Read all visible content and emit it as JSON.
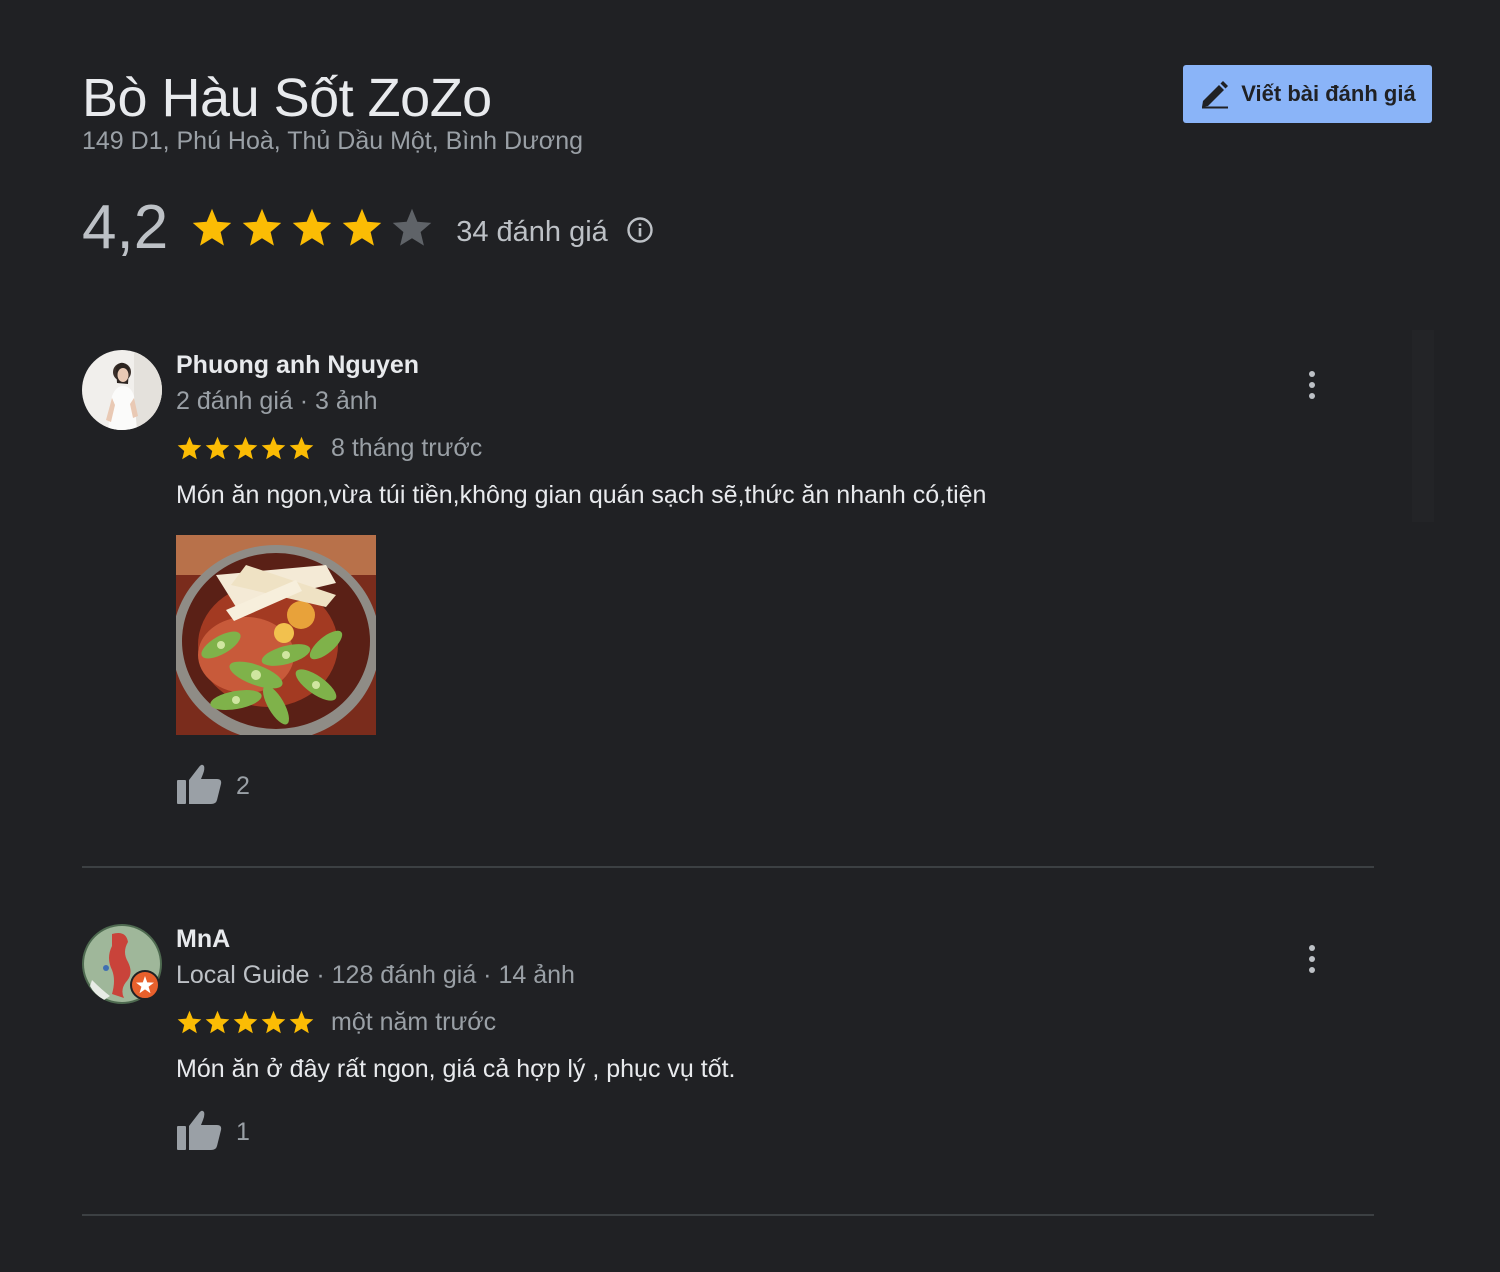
{
  "place": {
    "name": "Bò Hàu Sốt ZoZo",
    "address": "149 D1, Phú Hoà, Thủ Dầu Một, Bình Dương"
  },
  "write_review": {
    "label": "Viết bài đánh giá",
    "icon": "pencil-icon"
  },
  "rating": {
    "value": "4,2",
    "stars": 4.2,
    "count_label": "34 đánh giá",
    "info_icon": "info-icon"
  },
  "colors": {
    "background": "#202124",
    "star_filled": "#fbbc04",
    "star_empty": "#5f6368",
    "button": "#8ab4f8",
    "divider": "#3c4043"
  },
  "reviews": [
    {
      "name": "Phuong anh Nguyen",
      "meta": "2 đánh giá · 3 ảnh",
      "stars": 5,
      "time": "8 tháng trước",
      "text": "Món ăn ngon,vừa túi tiền,không gian quán sạch sẽ,thức ăn nhanh có,tiện",
      "likes": "2",
      "has_photo": true
    },
    {
      "name": "MnA",
      "guide": "Local Guide",
      "meta": " · 128 đánh giá · 14 ảnh",
      "stars": 5,
      "time": "một năm trước",
      "text": "Món ăn ở đây rất ngon, giá cả hợp lý , phục vụ tốt.",
      "likes": "1",
      "has_photo": false
    }
  ]
}
